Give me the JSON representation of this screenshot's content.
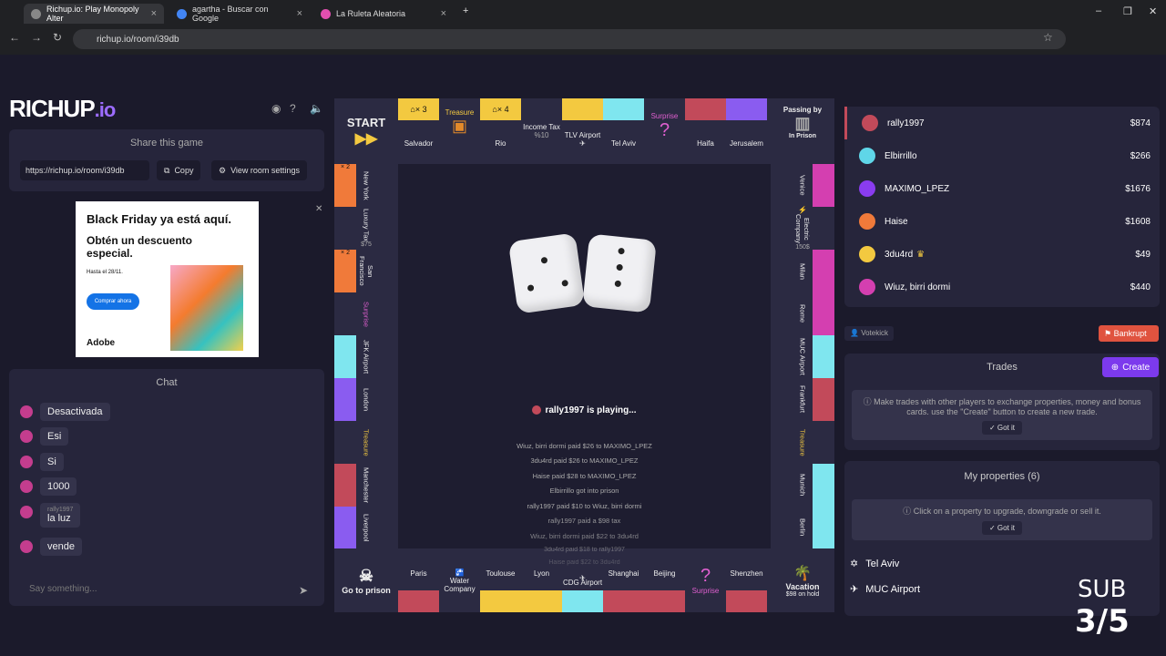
{
  "browser": {
    "tabs": [
      {
        "label": "Richup.io: Play Monopoly Alter",
        "active": true
      },
      {
        "label": "agartha - Buscar con Google",
        "active": false
      },
      {
        "label": "La Ruleta Aleatoria",
        "active": false
      }
    ],
    "url": "richup.io/room/i39db"
  },
  "logo": {
    "main": "RICHUP",
    "suffix": ".io"
  },
  "share": {
    "title": "Share this game",
    "url": "https://richup.io/room/i39db",
    "copy_label": "Copy",
    "settings_label": "View room settings"
  },
  "ad": {
    "headline": "Black Friday ya está aquí.",
    "sub": "Obtén un descuento especial.",
    "small": "Hasta el 28/11.",
    "cta": "Comprar ahora",
    "brand": "Adobe"
  },
  "chat": {
    "title": "Chat",
    "messages": [
      {
        "author": "",
        "text": "Desactivada"
      },
      {
        "author": "",
        "text": "Esi"
      },
      {
        "author": "",
        "text": "Si"
      },
      {
        "author": "",
        "text": "1000"
      },
      {
        "author": "rally1997",
        "text": "la luz"
      },
      {
        "author": "",
        "text": "vende"
      }
    ],
    "placeholder": "Say something..."
  },
  "board": {
    "top": [
      {
        "name": "START",
        "sub": ""
      },
      {
        "name": "Salvador",
        "badge": "× 3"
      },
      {
        "name": "Treasure"
      },
      {
        "name": "Rio",
        "badge": "× 4"
      },
      {
        "name": "Income Tax",
        "sub": "%10"
      },
      {
        "name": "TLV Airport"
      },
      {
        "name": "Tel Aviv"
      },
      {
        "name": "Surprise"
      },
      {
        "name": "Haifa"
      },
      {
        "name": "Jerusalem"
      },
      {
        "name": "Passing by",
        "sub": "In Prison"
      }
    ],
    "left": [
      {
        "name": "New York",
        "badge": "× 2"
      },
      {
        "name": "Luxury Tax",
        "sub": "$75"
      },
      {
        "name": "San Francisco",
        "badge": "× 2"
      },
      {
        "name": "Surprise"
      },
      {
        "name": "JFK Airport"
      },
      {
        "name": "London"
      },
      {
        "name": "Treasure"
      },
      {
        "name": "Manchester"
      },
      {
        "name": "Liverpool"
      }
    ],
    "right": [
      {
        "name": "Venice"
      },
      {
        "name": "Electric Company",
        "sub": "150$"
      },
      {
        "name": "Milan"
      },
      {
        "name": "Rome"
      },
      {
        "name": "MUC Airport"
      },
      {
        "name": "Frankfurt"
      },
      {
        "name": "Treasure"
      },
      {
        "name": "Munich"
      },
      {
        "name": "Berlin"
      }
    ],
    "bottom": [
      {
        "name": "Go to prison"
      },
      {
        "name": "Paris"
      },
      {
        "name": "Water Company"
      },
      {
        "name": "Toulouse"
      },
      {
        "name": "Lyon"
      },
      {
        "name": "CDG Airport"
      },
      {
        "name": "Shanghai"
      },
      {
        "name": "Beijing"
      },
      {
        "name": "Surprise"
      },
      {
        "name": "Shenzhen"
      },
      {
        "name": "Vacation",
        "sub": "$98 on hold"
      }
    ],
    "status": "rally1997  is playing...",
    "log": [
      "Wiuz, birri dormi  paid $26 to  MAXIMO_LPEZ",
      "3du4rd  paid $26 to  MAXIMO_LPEZ",
      "Haise  paid $28 to  MAXIMO_LPEZ",
      "Elbirrillo  got into prison",
      "rally1997  paid $10 to  Wiuz, birri dormi",
      "rally1997  paid a $98 tax",
      "Wiuz, birri dormi  paid $22 to  3du4rd",
      "3du4rd  paid $18 to  rally1997",
      "Haise  paid $22 to  3du4rd"
    ]
  },
  "players": [
    {
      "name": "rally1997",
      "money": "$874",
      "color": "#c24a5a"
    },
    {
      "name": "Elbirrillo",
      "money": "$266",
      "color": "#5fd6e8"
    },
    {
      "name": "MAXIMO_LPEZ",
      "money": "$1676",
      "color": "#8a3cf0"
    },
    {
      "name": "Haise",
      "money": "$1608",
      "color": "#f07a3a"
    },
    {
      "name": "3du4rd",
      "money": "$49",
      "color": "#f3c940"
    },
    {
      "name": "Wiuz, birri dormi",
      "money": "$440",
      "color": "#d43fb0"
    }
  ],
  "actions": {
    "votekick": "Votekick",
    "bankrupt": "Bankrupt"
  },
  "trades": {
    "title": "Trades",
    "create": "Create",
    "info": "Make trades with other players to exchange properties, money and bonus cards. use the \"Create\" button to create a new trade.",
    "got_it": "Got it"
  },
  "properties": {
    "title": "My properties (6)",
    "info": "Click on a property to upgrade, downgrade or sell it.",
    "got_it": "Got it",
    "items": [
      "Tel Aviv",
      "MUC Airport"
    ]
  },
  "overlay": {
    "line1": "SUB",
    "line2": "3/5"
  }
}
